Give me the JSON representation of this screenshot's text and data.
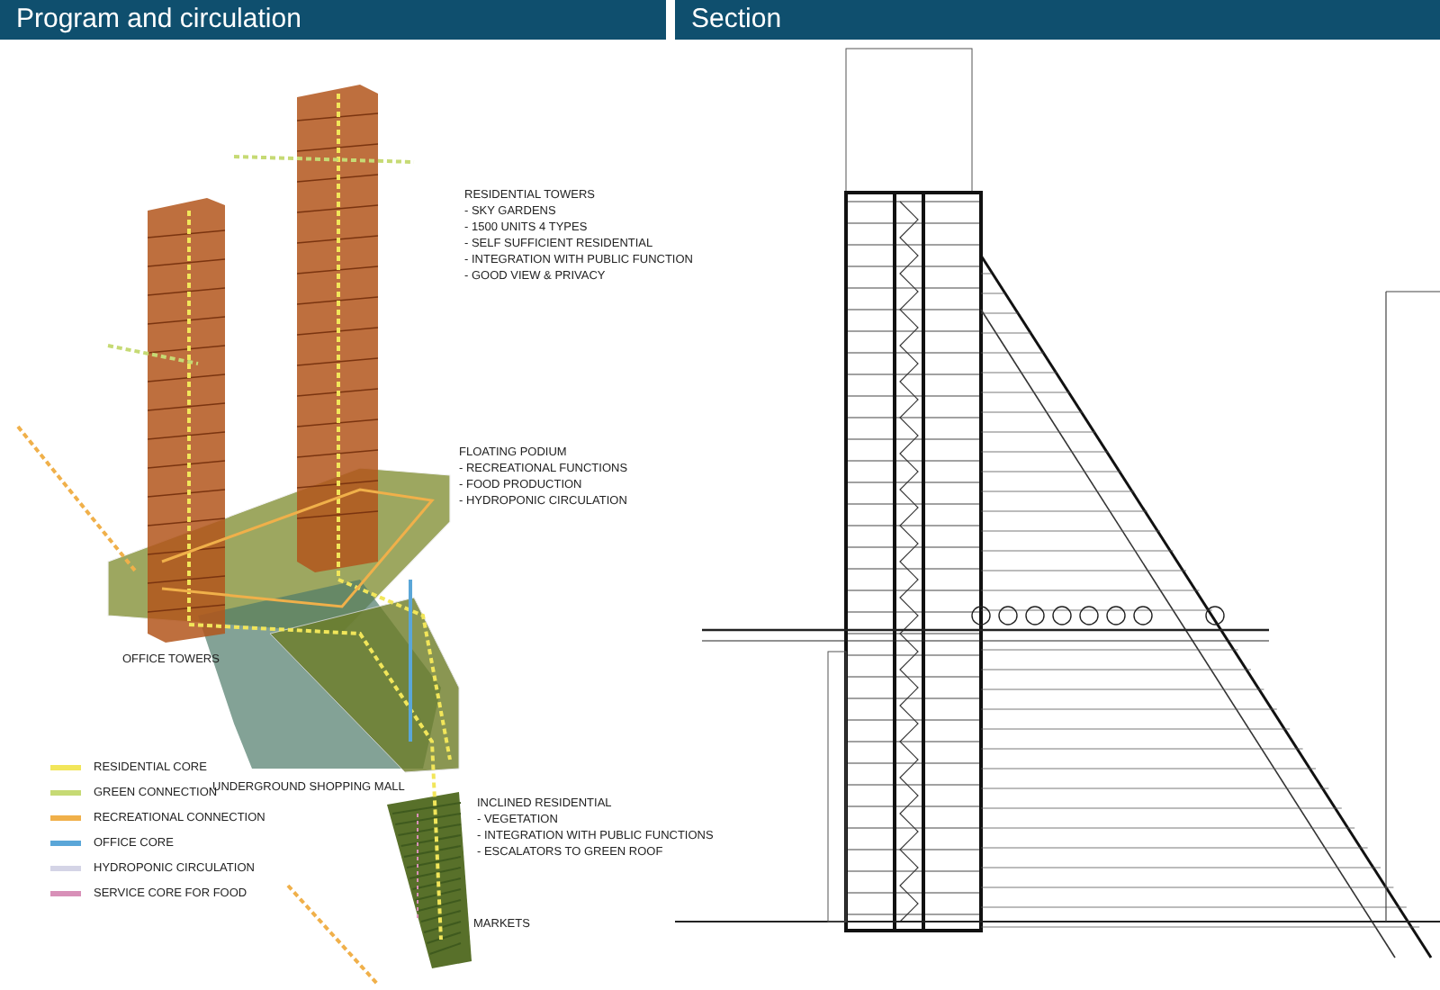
{
  "panels": [
    {
      "kind": "diagram",
      "title": "Program and circulation",
      "annotations": [
        {
          "title": "RESIDENTIAL TOWERS",
          "items": [
            "- SKY GARDENS",
            "- 1500 UNITS 4 TYPES",
            "- SELF SUFFICIENT RESIDENTIAL",
            "- INTEGRATION WITH PUBLIC FUNCTION",
            "- GOOD VIEW & PRIVACY"
          ]
        },
        {
          "title": "FLOATING PODIUM",
          "items": [
            "- RECREATIONAL FUNCTIONS",
            "- FOOD PRODUCTION",
            "- HYDROPONIC CIRCULATION"
          ]
        },
        {
          "title": "OFFICE TOWERS"
        },
        {
          "title": "UNDERGROUND SHOPPING MALL"
        },
        {
          "title": "INCLINED RESIDENTIAL",
          "items": [
            "- VEGETATION",
            "- INTEGRATION WITH PUBLIC FUNCTIONS",
            "- ESCALATORS TO GREEN ROOF"
          ]
        },
        {
          "title": "MARKETS"
        }
      ],
      "legend": [
        {
          "label": "RESIDENTIAL CORE",
          "color": "#f2e65a"
        },
        {
          "label": "GREEN CONNECTION",
          "color": "#c6da74"
        },
        {
          "label": "RECREATIONAL CONNECTION",
          "color": "#f0b04a"
        },
        {
          "label": "OFFICE CORE",
          "color": "#5aa6d8"
        },
        {
          "label": "HYDROPONIC CIRCULATION",
          "color": "#d4d4e6"
        },
        {
          "label": "SERVICE CORE FOR FOOD",
          "color": "#d890b8"
        }
      ]
    },
    {
      "kind": "section",
      "title": "Section"
    }
  ]
}
